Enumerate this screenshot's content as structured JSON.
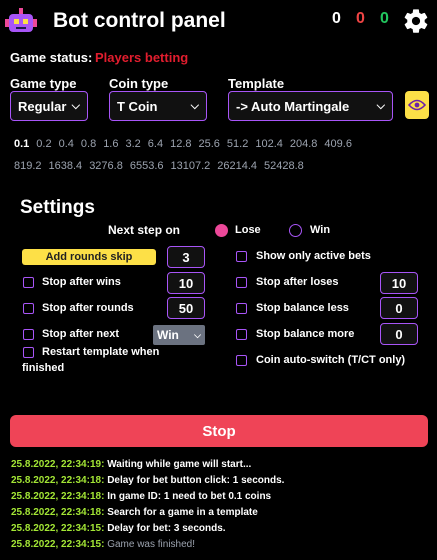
{
  "header": {
    "title": "Bot control panel",
    "counters": [
      {
        "value": "0",
        "color": "#ffffff"
      },
      {
        "value": "0",
        "color": "#ef4444"
      },
      {
        "value": "0",
        "color": "#22c55e"
      }
    ]
  },
  "status": {
    "label": "Game status:",
    "value": "Players betting"
  },
  "game_type": {
    "label": "Game type",
    "value": "Regular"
  },
  "coin_type": {
    "label": "Coin type",
    "value": "T Coin"
  },
  "template": {
    "label": "Template",
    "value": "-> Auto Martingale"
  },
  "bet_row_1": [
    "0.1",
    "0.2",
    "0.4",
    "0.8",
    "1.6",
    "3.2",
    "6.4",
    "12.8",
    "25.6",
    "51.2",
    "102.4",
    "204.8",
    "409.6"
  ],
  "bet_row_2": [
    "819.2",
    "1638.4",
    "3276.8",
    "6553.6",
    "13107.2",
    "26214.4",
    "52428.8"
  ],
  "settings": {
    "title": "Settings",
    "next_step_label": "Next step on",
    "lose_label": "Lose",
    "win_label": "Win",
    "add_rounds_skip": "Add rounds skip",
    "rounds_skip_value": "3",
    "stop_after_wins": "Stop after wins",
    "stop_after_wins_value": "10",
    "stop_after_rounds": "Stop after rounds",
    "stop_after_rounds_value": "50",
    "stop_after_next": "Stop after next",
    "stop_after_next_select": "Win",
    "restart_template": "Restart template when",
    "restart_template_2": "finished",
    "show_only_active_bets": "Show only active bets",
    "stop_after_loses": "Stop after loses",
    "stop_after_loses_value": "10",
    "stop_balance_less": "Stop balance less",
    "stop_balance_less_value": "0",
    "stop_balance_more": "Stop balance more",
    "stop_balance_more_value": "0",
    "coin_auto_switch": "Coin auto-switch (T/CT only)"
  },
  "stop_button": "Stop",
  "log": [
    {
      "ts": "25.8.2022, 22:34:19:",
      "msg": "Waiting while game will start..."
    },
    {
      "ts": "25.8.2022, 22:34:18:",
      "msg": "Delay for bet button click: 1 seconds."
    },
    {
      "ts": "25.8.2022, 22:34:18:",
      "msg": "In game ID: 1 need to bet 0.1 coins"
    },
    {
      "ts": "25.8.2022, 22:34:18:",
      "msg": "Search for a game in a template"
    },
    {
      "ts": "25.8.2022, 22:34:15:",
      "msg": "Delay for bet: 3 seconds."
    },
    {
      "ts": "25.8.2022, 22:34:15:",
      "msg": "Game was finished!"
    }
  ]
}
